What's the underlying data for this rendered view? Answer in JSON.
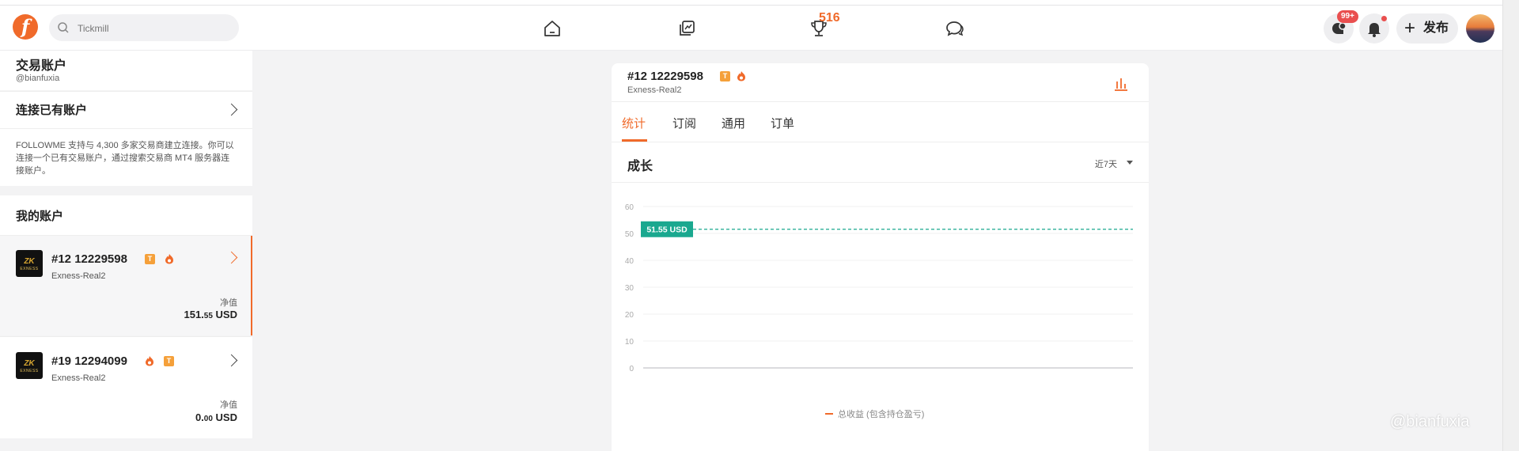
{
  "search": {
    "placeholder": "Tickmill"
  },
  "nav": {
    "trophy_count": "516"
  },
  "header_right": {
    "messages_badge": "99+",
    "publish_label": "发布"
  },
  "sidebar": {
    "title": "交易账户",
    "handle": "@bianfuxia",
    "connect": {
      "title": "连接已有账户",
      "description": "FOLLOWME 支持与 4,300 多家交易商建立连接。你可以连接一个已有交易账户，通过搜索交易商 MT4 服务器连接账户。"
    },
    "my_accounts_title": "我的账户",
    "accounts": [
      {
        "number": "#12   12229598",
        "server": "Exness-Real2",
        "netvalue_label": "净值",
        "netvalue_int": "151.",
        "netvalue_dec": "55",
        "currency": "USD"
      },
      {
        "number": "#19   12294099",
        "server": "Exness-Real2",
        "netvalue_label": "净值",
        "netvalue_int": "0.",
        "netvalue_dec": "00",
        "currency": "USD"
      }
    ],
    "broker_logo_text": "EXNESS"
  },
  "main": {
    "account_number": "#12   12229598",
    "server": "Exness-Real2",
    "tabs": [
      {
        "label": "统计",
        "active": true
      },
      {
        "label": "订阅",
        "active": false
      },
      {
        "label": "通用",
        "active": false
      },
      {
        "label": "订单",
        "active": false
      }
    ],
    "section_title": "成长",
    "period": "近7天"
  },
  "chart_data": {
    "type": "line",
    "title": "",
    "xlabel": "",
    "ylabel": "",
    "ylim": [
      0,
      60
    ],
    "yticks": [
      0,
      10,
      20,
      30,
      40,
      50,
      60
    ],
    "current_value_label": "51.55 USD",
    "reference_line": 51.55,
    "series": [
      {
        "name": "总收益 (包含持仓盈亏)",
        "color": "#f06a2a",
        "values": []
      }
    ],
    "grid": true,
    "legend_position": "bottom"
  },
  "colors": {
    "accent": "#f06a2a",
    "teal": "#1aa88f",
    "badge_red": "#e94f4f"
  },
  "watermark": "@bianfuxia"
}
